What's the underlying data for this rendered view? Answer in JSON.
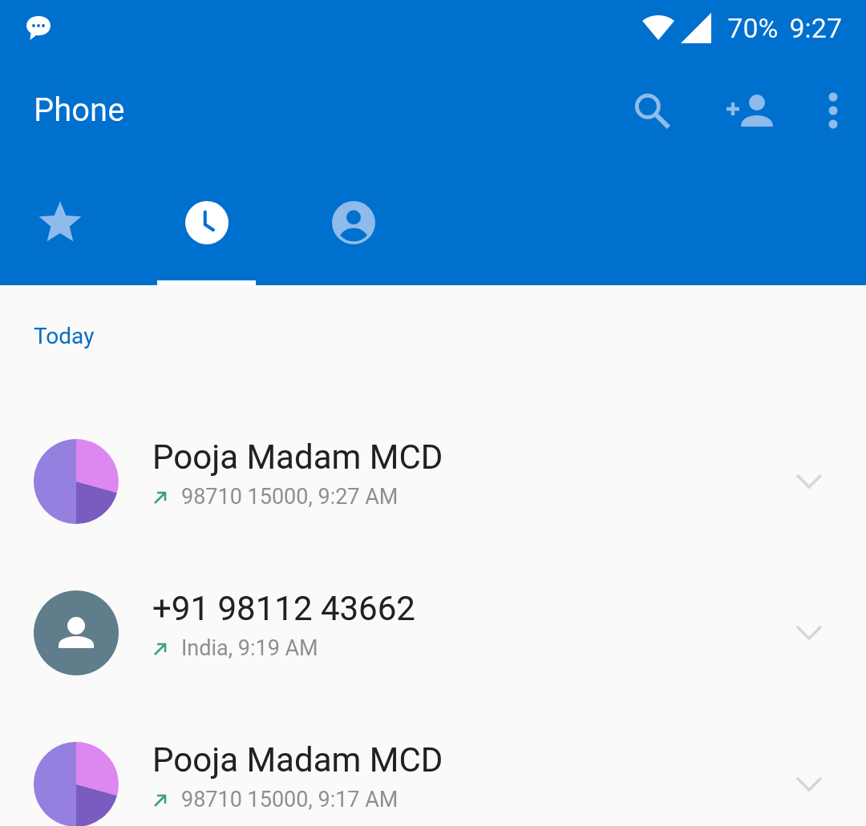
{
  "status_bar": {
    "battery": "70%",
    "time": "9:27"
  },
  "toolbar": {
    "title": "Phone"
  },
  "tabs": [
    {
      "kind": "favorites",
      "selected": false
    },
    {
      "kind": "recents",
      "selected": true
    },
    {
      "kind": "contacts",
      "selected": false
    }
  ],
  "section": {
    "header": "Today"
  },
  "calls": [
    {
      "avatar": {
        "kind": "pie"
      },
      "name": "Pooja Madam MCD",
      "kind": "outgoing",
      "detail": "98710 15000, 9:27 AM"
    },
    {
      "avatar": {
        "kind": "person"
      },
      "name": "+91 98112 43662",
      "kind": "outgoing",
      "detail": "India, 9:19 AM"
    },
    {
      "avatar": {
        "kind": "pie"
      },
      "name": "Pooja Madam MCD",
      "kind": "outgoing",
      "detail": "98710 15000, 9:17 AM"
    }
  ]
}
